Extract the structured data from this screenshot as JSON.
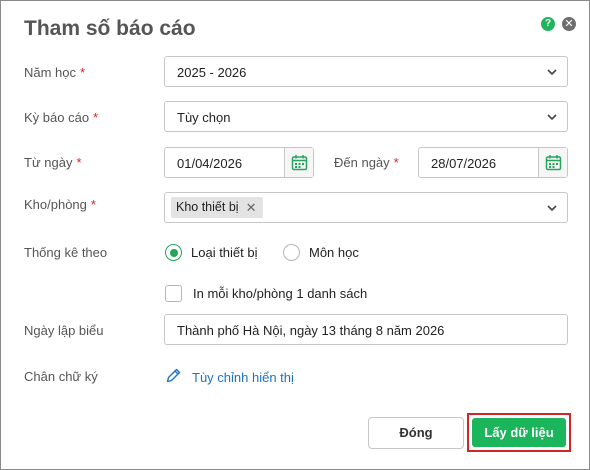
{
  "dialog": {
    "title": "Tham số báo cáo",
    "help_glyph": "?",
    "close_glyph": "✕"
  },
  "fields": {
    "school_year": {
      "label": "Năm học",
      "required": "*",
      "value": "2025 - 2026"
    },
    "period": {
      "label": "Kỳ báo cáo",
      "required": "*",
      "value": "Tùy chọn"
    },
    "from_date": {
      "label": "Từ ngày",
      "required": "*",
      "value": "01/04/2026"
    },
    "to_date": {
      "label": "Đến ngày",
      "required": "*",
      "value": "28/07/2026"
    },
    "warehouse": {
      "label": "Kho/phòng",
      "required": "*",
      "chips": [
        "Kho thiết bị"
      ],
      "chip_remove": "✕"
    },
    "stat_by": {
      "label": "Thống kê theo",
      "options": [
        {
          "label": "Loại thiết bị",
          "selected": true
        },
        {
          "label": "Môn học",
          "selected": false
        }
      ]
    },
    "print_each": {
      "label": "In mỗi kho/phòng 1 danh sách",
      "checked": false
    },
    "report_date": {
      "label": "Ngày lập biểu",
      "value": "Thành phố Hà Nội, ngày 13 tháng 8 năm 2026"
    },
    "signature": {
      "label": "Chân chữ ký",
      "link": "Tùy chỉnh hiển thị"
    }
  },
  "buttons": {
    "close": "Đóng",
    "fetch": "Lấy dữ liệu"
  },
  "colors": {
    "accent": "#1bb55c",
    "required": "#e02020",
    "link": "#1a73c8",
    "highlight_frame": "#d42424"
  },
  "icons": [
    "help-icon",
    "close-icon",
    "chevron-down-icon",
    "calendar-icon",
    "pencil-icon",
    "remove-chip-icon"
  ]
}
